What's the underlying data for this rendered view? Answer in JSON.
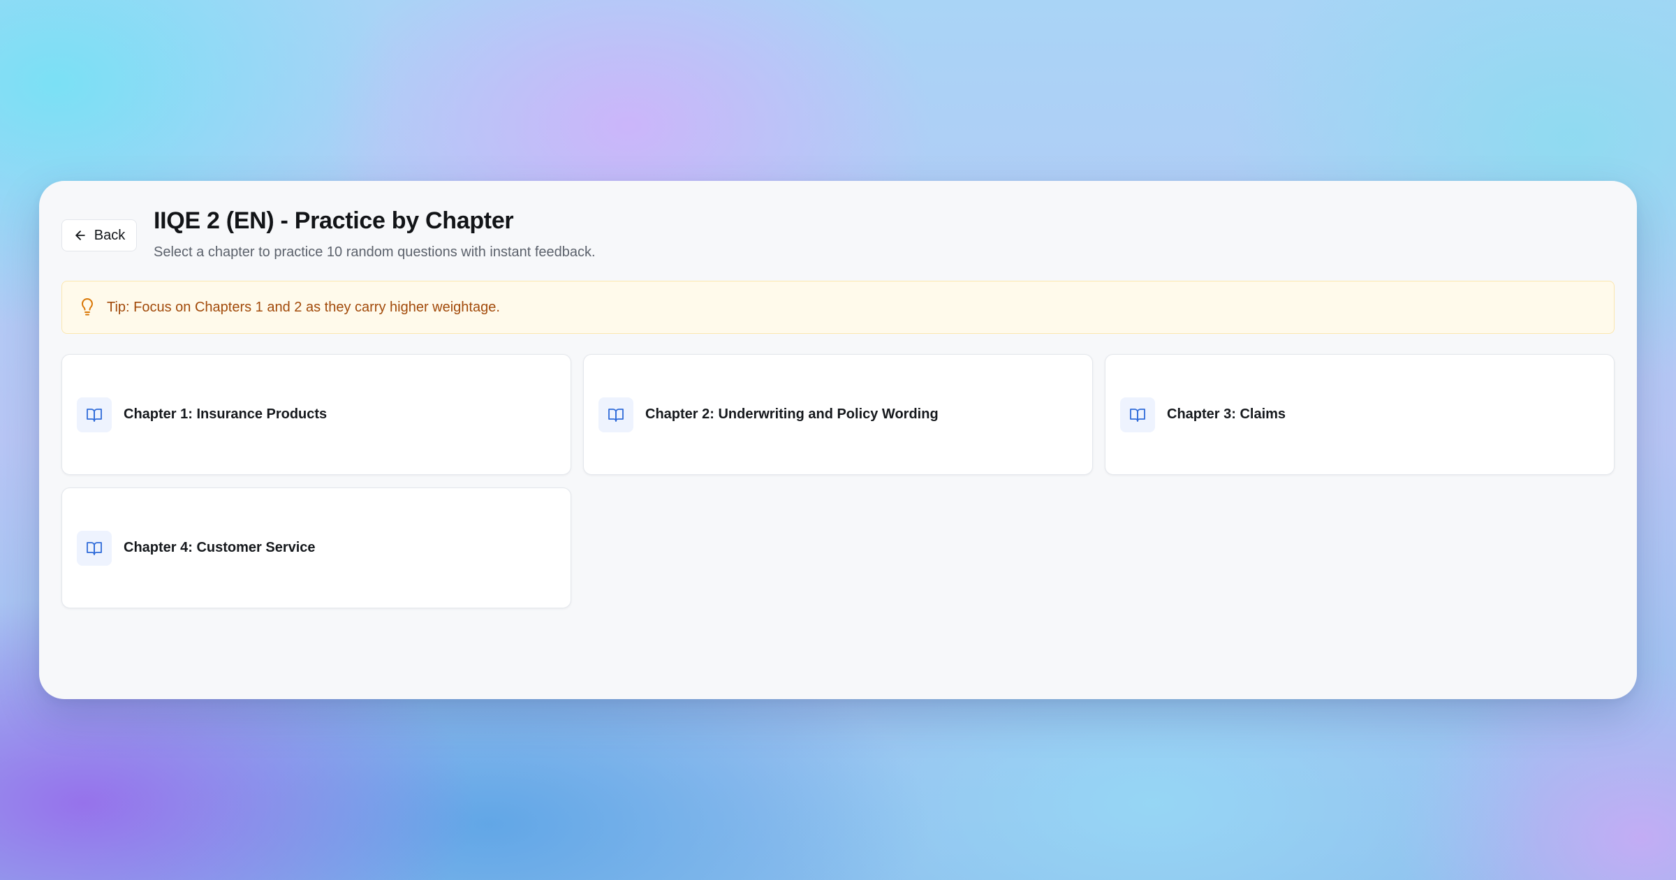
{
  "header": {
    "back_label": "Back",
    "title": "IIQE 2 (EN) - Practice by Chapter",
    "subtitle": "Select a chapter to practice 10 random questions with instant feedback."
  },
  "tip": {
    "text": "Tip: Focus on Chapters 1 and 2 as they carry higher weightage.",
    "icon": "lightbulb-icon"
  },
  "chapters": [
    {
      "label": "Chapter 1: Insurance Products",
      "icon": "book-open-icon"
    },
    {
      "label": "Chapter 2: Underwriting and Policy Wording",
      "icon": "book-open-icon"
    },
    {
      "label": "Chapter 3: Claims",
      "icon": "book-open-icon"
    },
    {
      "label": "Chapter 4: Customer Service",
      "icon": "book-open-icon"
    }
  ],
  "colors": {
    "accent_blue": "#2f6bd9",
    "tip_text": "#a24a0a",
    "tip_background": "#fffaeb",
    "tip_icon": "#d97706"
  }
}
